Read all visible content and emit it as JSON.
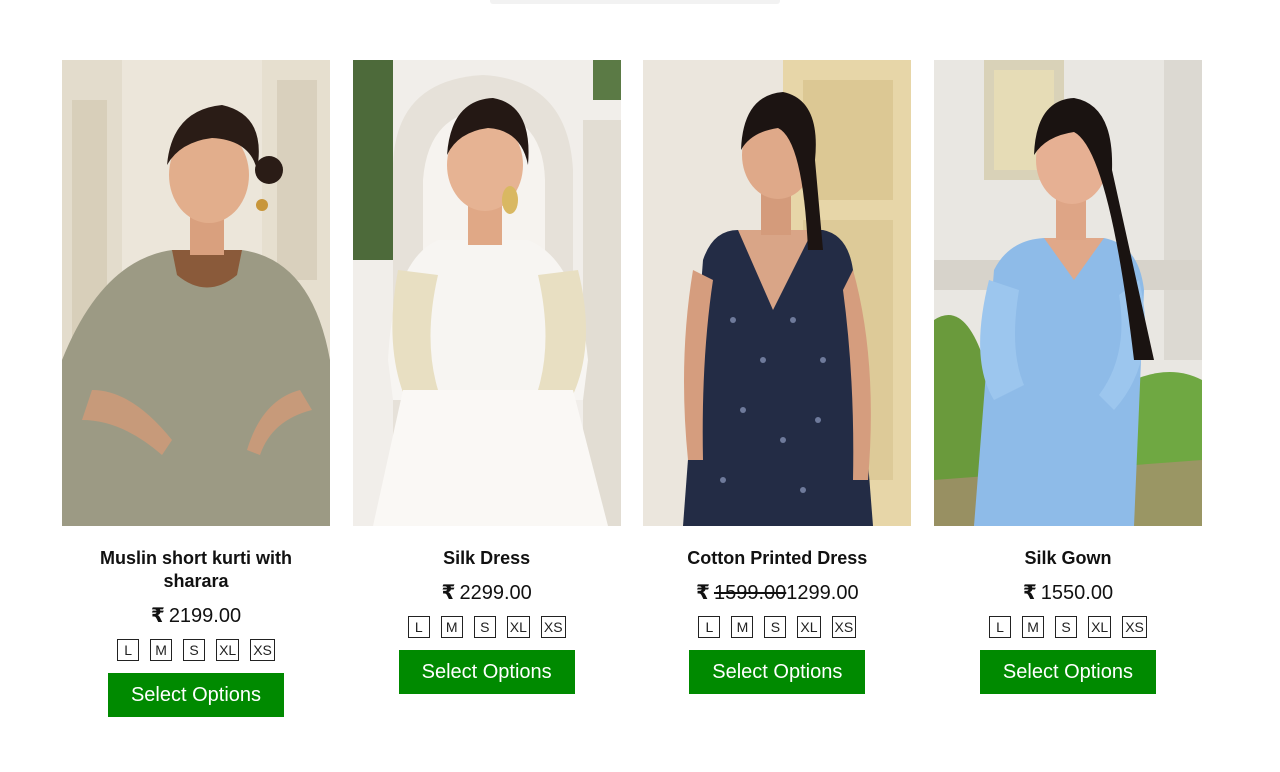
{
  "currency_symbol": "₹",
  "products": [
    {
      "name": "Muslin short kurti with sharara",
      "price": "2199.00",
      "sizes": [
        "L",
        "M",
        "S",
        "XL",
        "XS"
      ],
      "button_label": "Select Options",
      "image_alt": "Model wearing grey muslin short kurti with sharara"
    },
    {
      "name": "Silk Dress",
      "price": "2299.00",
      "sizes": [
        "L",
        "M",
        "S",
        "XL",
        "XS"
      ],
      "button_label": "Select Options",
      "image_alt": "Model wearing white silk dress with gold embroidered sleeves"
    },
    {
      "name": "Cotton Printed Dress",
      "old_price": "1599.00",
      "price": "1299.00",
      "sizes": [
        "L",
        "M",
        "S",
        "XL",
        "XS"
      ],
      "button_label": "Select Options",
      "image_alt": "Model wearing navy cotton printed sleeveless dress"
    },
    {
      "name": "Silk Gown",
      "price": "1550.00",
      "sizes": [
        "L",
        "M",
        "S",
        "XL",
        "XS"
      ],
      "button_label": "Select Options",
      "image_alt": "Model wearing light blue silk gown"
    }
  ],
  "colors": {
    "button_bg": "#008a00",
    "button_text": "#ffffff"
  }
}
